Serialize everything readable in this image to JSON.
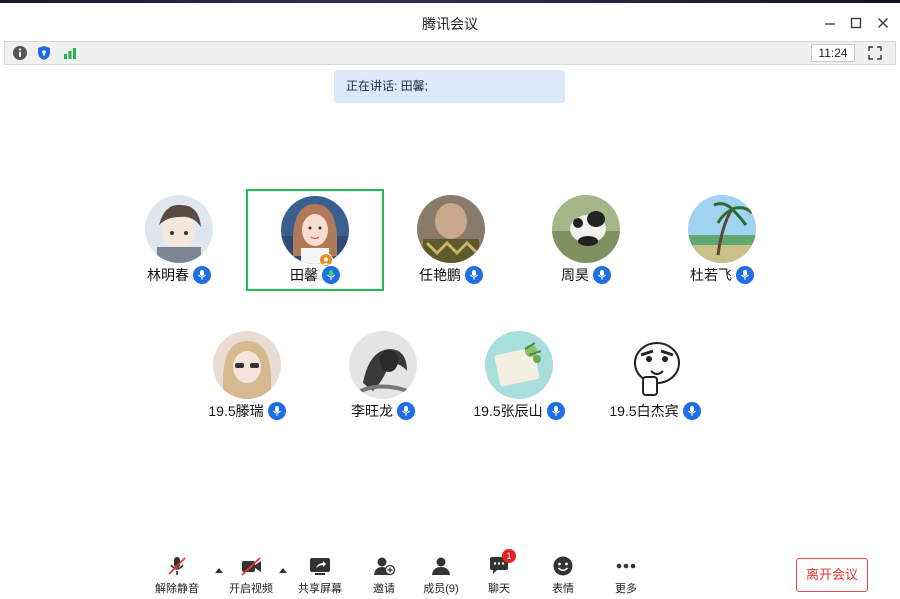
{
  "window": {
    "title": "腾讯会议"
  },
  "toolbar": {
    "clock": "11:24"
  },
  "speaking": {
    "text": "正在讲话: 田馨;"
  },
  "participants": [
    {
      "name": "林明春"
    },
    {
      "name": "田馨"
    },
    {
      "name": "任艳鹏"
    },
    {
      "name": "周昊"
    },
    {
      "name": "杜若飞"
    },
    {
      "name": "19.5滕瑞"
    },
    {
      "name": "李旺龙"
    },
    {
      "name": "19.5张辰山"
    },
    {
      "name": "19.5白杰宾"
    }
  ],
  "bottom": {
    "unmute": "解除静音",
    "video": "开启视频",
    "share": "共享屏幕",
    "invite": "邀请",
    "members": "成员(9)",
    "chat": "聊天",
    "chat_badge": "1",
    "emoji": "表情",
    "more": "更多",
    "leave": "离开会议"
  },
  "colors": {
    "accent": "#1e6fe6",
    "active_border": "#1fbb55",
    "leave": "#e33333",
    "speaking_bg": "#dbe9fb"
  }
}
